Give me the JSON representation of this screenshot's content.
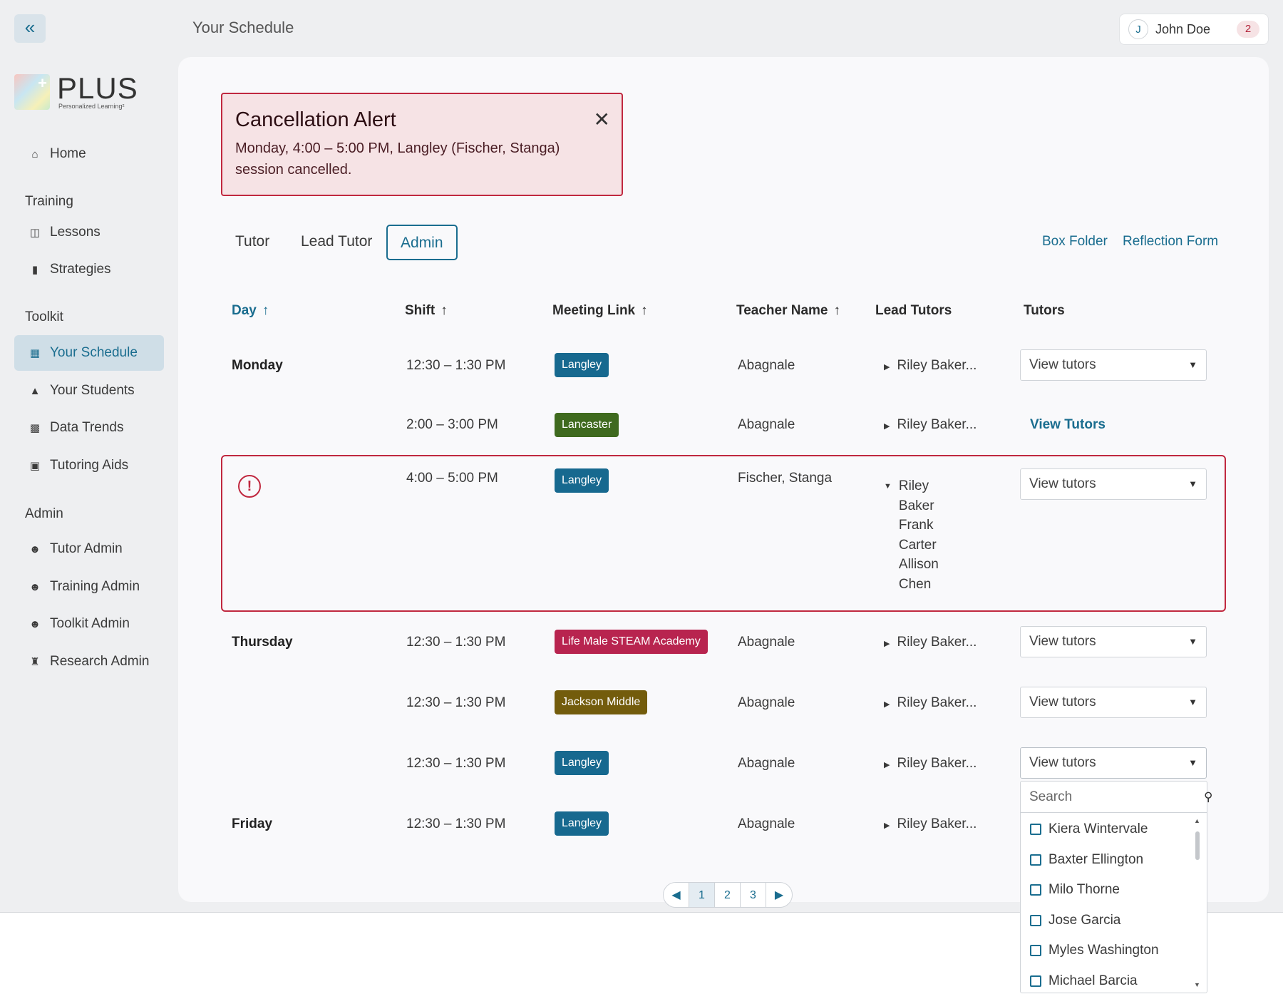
{
  "header": {
    "collapse_glyph": "«",
    "page_title": "Your Schedule",
    "user": {
      "initial": "J",
      "name": "John Doe",
      "notifications": "2"
    }
  },
  "logo": {
    "title": "PLUS",
    "subtitle": "Personalized Learning²"
  },
  "sidebar": {
    "home": "Home",
    "training_heading": "Training",
    "lessons": "Lessons",
    "strategies": "Strategies",
    "toolkit_heading": "Toolkit",
    "your_schedule": "Your Schedule",
    "your_students": "Your Students",
    "data_trends": "Data Trends",
    "tutoring_aids": "Tutoring Aids",
    "admin_heading": "Admin",
    "tutor_admin": "Tutor Admin",
    "training_admin": "Training Admin",
    "toolkit_admin": "Toolkit Admin",
    "research_admin": "Research Admin"
  },
  "alert": {
    "title": "Cancellation Alert",
    "body": "Monday, 4:00 – 5:00 PM, Langley (Fischer,  Stanga) session cancelled.",
    "close_glyph": "✕"
  },
  "tabs": {
    "tutor": "Tutor",
    "lead_tutor": "Lead Tutor",
    "admin": "Admin"
  },
  "links": {
    "box_folder": "Box Folder",
    "reflection_form": "Reflection Form"
  },
  "table": {
    "headers": {
      "day": "Day",
      "shift": "Shift",
      "meeting_link": "Meeting Link",
      "teacher_name": "Teacher Name",
      "lead_tutors": "Lead Tutors",
      "tutors": "Tutors"
    },
    "rows": [
      {
        "day": "Monday",
        "shift": "12:30 – 1:30 PM",
        "meeting": "Langley",
        "teacher": "Abagnale",
        "lead": "Riley Baker...",
        "tutors": "View tutors"
      },
      {
        "day": "",
        "shift": "2:00 – 3:00 PM",
        "meeting": "Lancaster",
        "teacher": "Abagnale",
        "lead": "Riley Baker...",
        "tutors": "View Tutors"
      },
      {
        "day": "",
        "shift": "4:00 – 5:00 PM",
        "meeting": "Langley",
        "teacher": "Fischer, Stanga",
        "lead_names": "Riley Baker Frank Carter Allison Chen",
        "tutors": "View tutors"
      },
      {
        "day": "Thursday",
        "shift": "12:30 – 1:30 PM",
        "meeting": "Life Male STEAM Academy",
        "teacher": "Abagnale",
        "lead": "Riley Baker...",
        "tutors": "View tutors"
      },
      {
        "day": "",
        "shift": "12:30 – 1:30 PM",
        "meeting": "Jackson Middle",
        "teacher": "Abagnale",
        "lead": "Riley Baker...",
        "tutors": "View tutors"
      },
      {
        "day": "",
        "shift": "12:30 – 1:30 PM",
        "meeting": "Langley",
        "teacher": "Abagnale",
        "lead": "Riley Baker...",
        "tutors": "View tutors"
      },
      {
        "day": "Friday",
        "shift": "12:30 – 1:30 PM",
        "meeting": "Langley",
        "teacher": "Abagnale",
        "lead": "Riley Baker..."
      }
    ]
  },
  "dropdown": {
    "search_placeholder": "Search",
    "options": [
      "Kiera Wintervale",
      "Baxter Ellington",
      "Milo Thorne",
      "Jose Garcia",
      "Myles Washington",
      "Michael Barcia"
    ]
  },
  "pagination": {
    "pages": [
      "1",
      "2",
      "3"
    ],
    "current": "1"
  },
  "colors": {
    "accent": "#1a6d8f",
    "alert_border": "#c0283f",
    "alert_bg": "#f6e3e5",
    "langley": "#17698f",
    "lancaster": "#3f6a1e",
    "steam": "#b8244f",
    "jackson": "#735c0c"
  },
  "icons": {
    "home": "house-icon",
    "lessons": "book-icon",
    "strategies": "clipboard-icon",
    "schedule": "calendar-icon",
    "students": "graduation-cap-icon",
    "trends": "bar-chart-icon",
    "aids": "toolbox-icon",
    "tutor_admin": "user-edit-icon",
    "training_admin": "user-check-icon",
    "toolkit_admin": "user-gear-icon",
    "research_admin": "building-icon"
  }
}
